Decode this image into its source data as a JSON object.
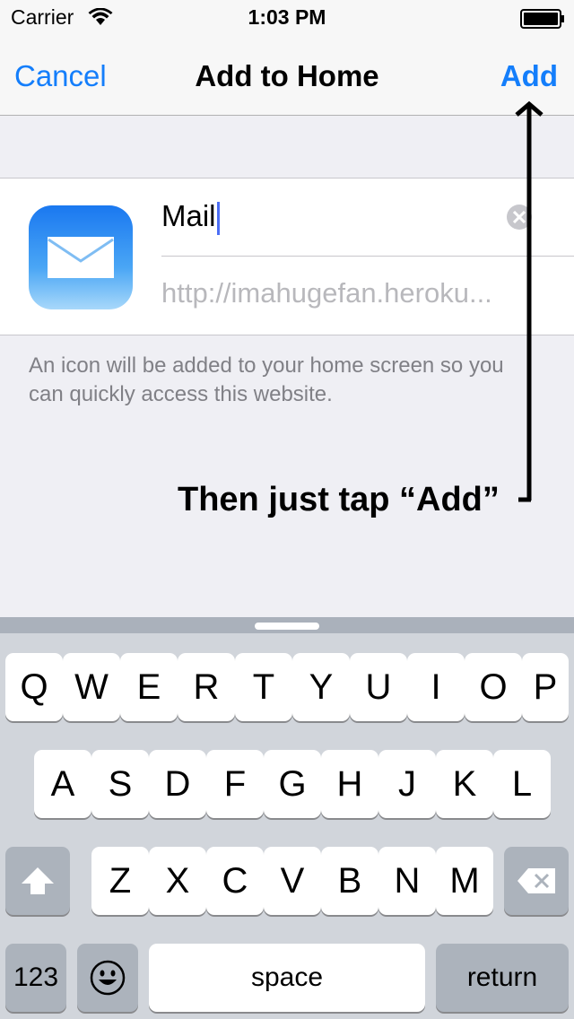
{
  "status_bar": {
    "carrier": "Carrier",
    "time": "1:03 PM"
  },
  "nav": {
    "cancel_label": "Cancel",
    "title": "Add to Home",
    "add_label": "Add"
  },
  "form": {
    "app_icon": "mail-app-icon",
    "name_value": "Mail",
    "url_value": "http://imahugefan.heroku...",
    "hint": "An icon will be added to your home screen so you can quickly access this website."
  },
  "annotation": {
    "text": "Then just tap “Add”"
  },
  "keyboard": {
    "row1": [
      "Q",
      "W",
      "E",
      "R",
      "T",
      "Y",
      "U",
      "I",
      "O",
      "P"
    ],
    "row2": [
      "A",
      "S",
      "D",
      "F",
      "G",
      "H",
      "J",
      "K",
      "L"
    ],
    "row3": [
      "Z",
      "X",
      "C",
      "V",
      "B",
      "N",
      "M"
    ],
    "numbers_label": "123",
    "space_label": "space",
    "return_label": "return",
    "shift_icon": "shift-icon",
    "delete_icon": "delete-icon",
    "emoji_icon": "emoji-icon"
  },
  "colors": {
    "accent": "#147efb",
    "keyboard_bg": "#d1d5db",
    "caret": "#4c6ef5"
  }
}
